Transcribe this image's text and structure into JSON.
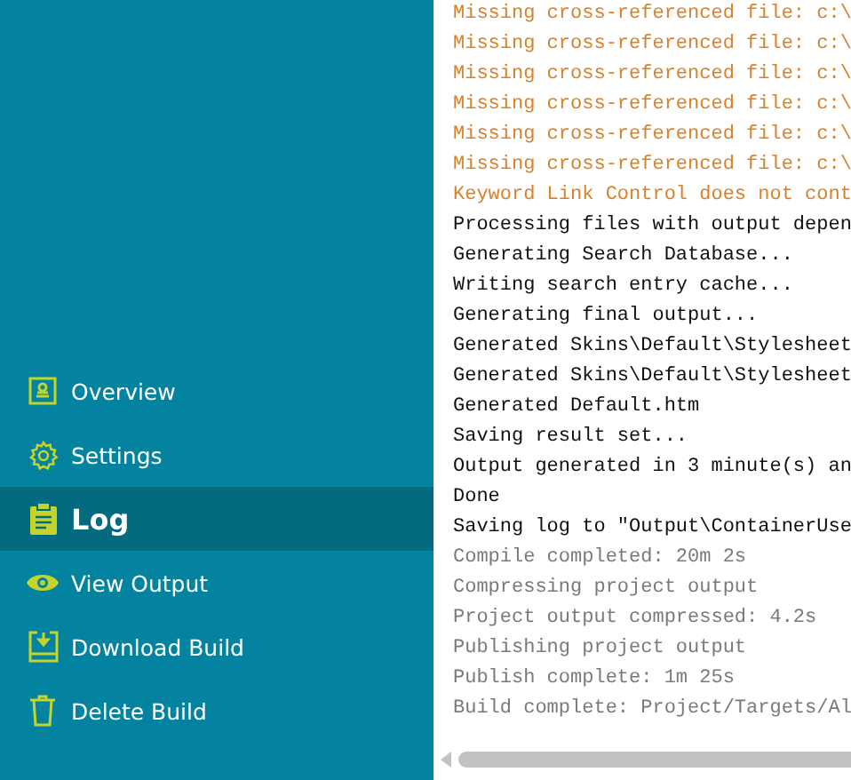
{
  "sidebar": {
    "items": [
      {
        "label": "Overview",
        "kind": "overview",
        "selected": false
      },
      {
        "label": "Settings",
        "kind": "settings",
        "selected": false
      },
      {
        "label": "Log",
        "kind": "log",
        "selected": true
      },
      {
        "label": "View Output",
        "kind": "view",
        "selected": false
      },
      {
        "label": "Download Build",
        "kind": "download",
        "selected": false
      },
      {
        "label": "Delete Build",
        "kind": "delete",
        "selected": false
      }
    ]
  },
  "log": {
    "lines": [
      {
        "text": "Missing cross-referenced file: c:\\",
        "kind": "warning"
      },
      {
        "text": "Missing cross-referenced file: c:\\",
        "kind": "warning"
      },
      {
        "text": "Missing cross-referenced file: c:\\",
        "kind": "warning"
      },
      {
        "text": "Missing cross-referenced file: c:\\",
        "kind": "warning"
      },
      {
        "text": "Missing cross-referenced file: c:\\",
        "kind": "warning"
      },
      {
        "text": "Missing cross-referenced file: c:\\",
        "kind": "warning"
      },
      {
        "text": "Keyword Link Control does not cont",
        "kind": "warning"
      },
      {
        "text": "Processing files with output depen",
        "kind": "normal"
      },
      {
        "text": "Generating Search Database...",
        "kind": "normal"
      },
      {
        "text": "Writing search entry cache...",
        "kind": "normal"
      },
      {
        "text": "Generating final output...",
        "kind": "normal"
      },
      {
        "text": "Generated Skins\\Default\\Stylesheet",
        "kind": "normal"
      },
      {
        "text": "Generated Skins\\Default\\Stylesheet",
        "kind": "normal"
      },
      {
        "text": "Generated Default.htm",
        "kind": "normal"
      },
      {
        "text": "Saving result set...",
        "kind": "normal"
      },
      {
        "text": "Output generated in 3 minute(s) an",
        "kind": "normal"
      },
      {
        "text": "Done",
        "kind": "normal"
      },
      {
        "text": "Saving log to \"Output\\ContainerUse",
        "kind": "normal"
      },
      {
        "text": "Compile completed: 20m 2s",
        "kind": "info"
      },
      {
        "text": "Compressing project output",
        "kind": "info"
      },
      {
        "text": "Project output compressed: 4.2s",
        "kind": "info"
      },
      {
        "text": "Publishing project output",
        "kind": "info"
      },
      {
        "text": "Publish complete: 1m 25s",
        "kind": "info"
      },
      {
        "text": "Build complete: Project/Targets/Al",
        "kind": "info"
      }
    ]
  }
}
